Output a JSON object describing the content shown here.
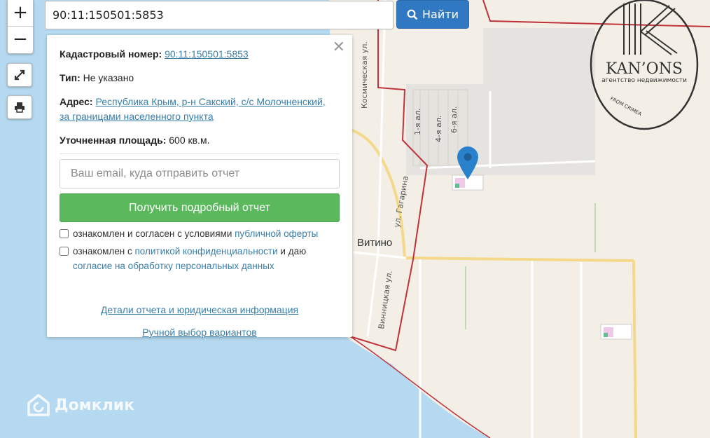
{
  "search": {
    "value": "90:11:150501:5853",
    "button_label": "Найти"
  },
  "zoom": {
    "in_label": "+",
    "out_label": "−"
  },
  "panel": {
    "close_label": "✕",
    "cadastral_label": "Кадастровый номер:",
    "cadastral_value": "90:11:150501:5853",
    "type_label": "Тип:",
    "type_value": "Не указано",
    "address_label": "Адрес:",
    "address_line1": "Республика Крым, р-н Сакский, с/с Молочненский,",
    "address_line2": "за границами населенного пункта",
    "area_label": "Уточненная площадь:",
    "area_value": "600 кв.м.",
    "email_placeholder": "Ваш email, куда отправить отчет",
    "report_button": "Получить подробный отчет",
    "consent1_text": "ознакомлен и согласен с условиями",
    "consent1_link": "публичной оферты",
    "consent2_text": "ознакомлен с",
    "consent2_link": "политикой конфиденциальности",
    "consent2_and": "и даю",
    "consent2_link2": "согласие на обработку персональных данных",
    "details_link": "Детали отчета и юридическая информация",
    "manual_link": "Ручной выбор вариантов"
  },
  "map": {
    "streets": {
      "kosmicheskaya": "Космическая ул.",
      "gagarina": "ул. Гагарина",
      "vinnitskaya": "Винницкая ул.",
      "al1": "1-я ал.",
      "al4": "4-я ал.",
      "al6": "6-я ал."
    },
    "town": "Витино",
    "watermark": "Домклик",
    "colors": {
      "sea": "#b5d9f0",
      "land": "#f3efe6",
      "boundary": "#c0323a",
      "road": "#f4d98a",
      "marker": "#2a81cb"
    }
  },
  "logo": {
    "brand": "KAN’ONS",
    "subtitle": "агентство недвижимости",
    "tagline": "FROM CRIMEA"
  }
}
